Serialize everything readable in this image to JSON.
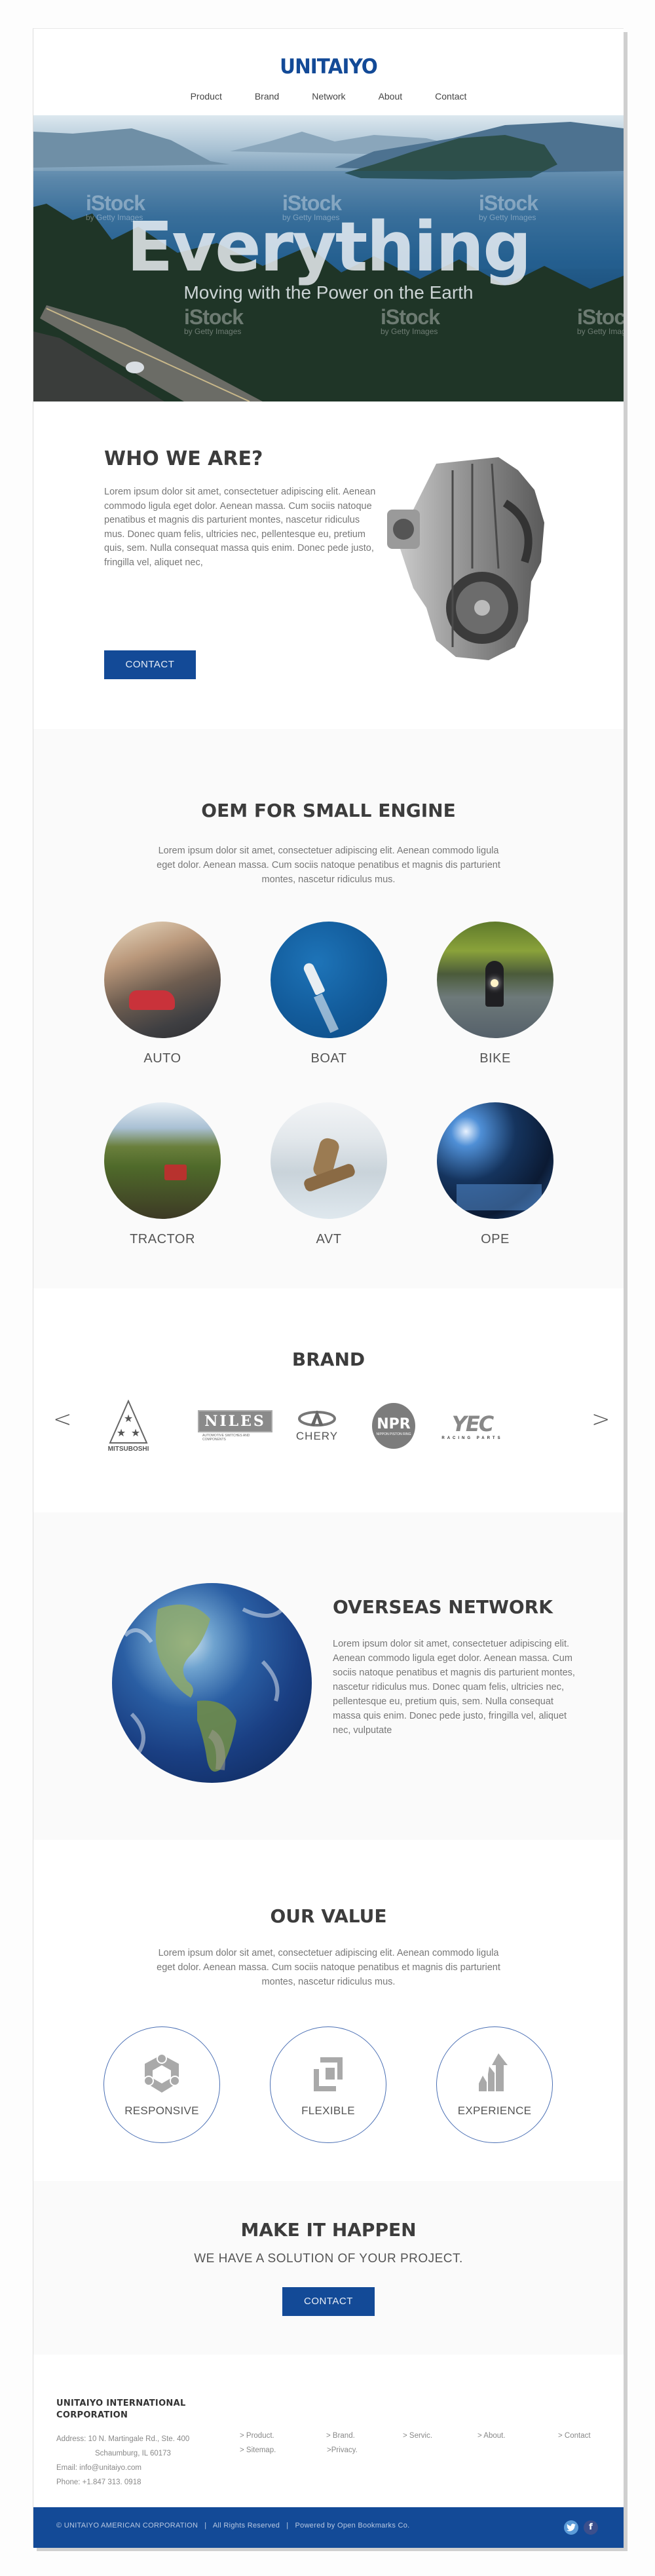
{
  "header": {
    "logo": "UNITAIYO",
    "nav": [
      "Product",
      "Brand",
      "Network",
      "About",
      "Contact"
    ]
  },
  "hero": {
    "title": "Everything",
    "subtitle": "Moving with the Power on the Earth",
    "watermark": "iStock",
    "watermark_sub": "by Getty Images"
  },
  "who": {
    "title": "WHO WE ARE?",
    "body": "Lorem ipsum dolor sit amet, consectetuer adipiscing elit. Aenean commodo ligula eget dolor. Aenean massa. Cum sociis natoque penatibus et magnis dis parturient montes, nascetur ridiculus mus. Donec quam felis, ultricies nec, pellentesque eu, pretium quis, sem. Nulla consequat massa quis enim. Donec pede justo, fringilla vel, aliquet nec,",
    "button": "CONTACT"
  },
  "oem": {
    "title": "OEM FOR SMALL ENGINE",
    "body": "Lorem ipsum dolor sit amet, consectetuer adipiscing elit. Aenean commodo ligula eget dolor. Aenean massa. Cum sociis natoque penatibus et magnis dis parturient montes, nascetur ridiculus mus.",
    "categories": [
      {
        "label": "AUTO"
      },
      {
        "label": "BOAT"
      },
      {
        "label": "BIKE"
      },
      {
        "label": "TRACTOR"
      },
      {
        "label": "AVT"
      },
      {
        "label": "OPE"
      }
    ]
  },
  "brand": {
    "title": "BRAND",
    "prev": "<",
    "next": ">",
    "logos": [
      {
        "name": "MITSUBOSHI"
      },
      {
        "name": "NILES",
        "tagline": "AUTOMOTIVE SWITCHES AND COMPONENTS"
      },
      {
        "name": "CHERY"
      },
      {
        "name": "NPR",
        "tagline": "NIPPON PISTON RING"
      },
      {
        "name": "YEC",
        "tagline": "RACING PARTS"
      }
    ]
  },
  "overseas": {
    "title": "OVERSEAS NETWORK",
    "body": "Lorem ipsum dolor sit amet, consectetuer adipiscing elit. Aenean commodo ligula eget dolor. Aenean massa. Cum sociis natoque penatibus et magnis dis parturient montes, nascetur ridiculus mus. Donec quam felis, ultricies nec, pellentesque eu, pretium quis, sem. Nulla consequat massa quis enim. Donec pede justo, fringilla vel, aliquet nec, vulputate"
  },
  "value": {
    "title": "OUR VALUE",
    "body": "Lorem ipsum dolor sit amet, consectetuer adipiscing elit. Aenean commodo ligula eget dolor. Aenean massa. Cum sociis natoque penatibus et magnis dis parturient montes, nascetur ridiculus mus.",
    "items": [
      {
        "label": "RESPONSIVE",
        "icon": "responsive-icon"
      },
      {
        "label": "FLEXIBLE",
        "icon": "flexible-icon"
      },
      {
        "label": "EXPERIENCE",
        "icon": "growth-arrow-icon"
      }
    ]
  },
  "cta": {
    "title": "MAKE IT HAPPEN",
    "subtitle": "WE HAVE A SOLUTION OF YOUR PROJECT.",
    "button": "CONTACT"
  },
  "footer": {
    "company": "UNITAIYO INTERNATIONAL CORPORATION",
    "address_line1": "Address: 10 N. Martingale Rd., Ste. 400",
    "address_line2": "Schaumburg, IL 60173",
    "email": "Email: info@unitaiyo.com",
    "phone": "Phone: +1.847 313. 0918",
    "links": [
      "> Product.",
      "> Brand.",
      "> Servic.",
      "> About.",
      "> Contact",
      "> Sitemap.",
      ">Privacy."
    ],
    "copyright": "© UNITAIYO AMERICAN CORPORATION   |   All Rights Reserved   |   Powered by Open Bookmarks Co.",
    "social": [
      "twitter",
      "facebook"
    ]
  },
  "colors": {
    "brand_blue": "#134a97",
    "section_gray": "#fafafa",
    "twitter": "#5b9bd8",
    "facebook": "#3b4f8c"
  }
}
